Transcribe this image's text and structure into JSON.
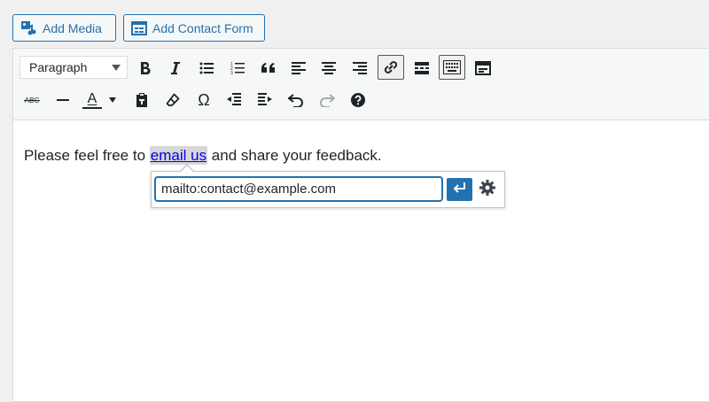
{
  "media_buttons": {
    "add_media": "Add Media",
    "add_contact_form": "Add Contact Form"
  },
  "toolbar": {
    "format_select": {
      "selected": "Paragraph"
    },
    "row1_icons": [
      "bold-icon",
      "italic-icon",
      "bulleted-list-icon",
      "numbered-list-icon",
      "blockquote-icon",
      "align-left-icon",
      "align-center-icon",
      "align-right-icon",
      "link-icon",
      "read-more-icon",
      "toolbar-toggle-icon",
      "distraction-free-icon"
    ],
    "row2_icons": [
      "strikethrough-icon",
      "horizontal-line-icon",
      "text-color-icon",
      "paste-as-text-icon",
      "clear-formatting-icon",
      "special-character-icon",
      "decrease-indent-icon",
      "increase-indent-icon",
      "undo-icon",
      "redo-icon",
      "help-icon"
    ],
    "strikethrough_label": "ABC",
    "text_color_label": "A"
  },
  "content": {
    "before": "Please feel free to ",
    "link_text": "email us",
    "after": " and share your feedback."
  },
  "link_popup": {
    "url_value": "mailto:contact@example.com"
  },
  "colors": {
    "accent": "#2271b1",
    "link": "#0000ee"
  }
}
